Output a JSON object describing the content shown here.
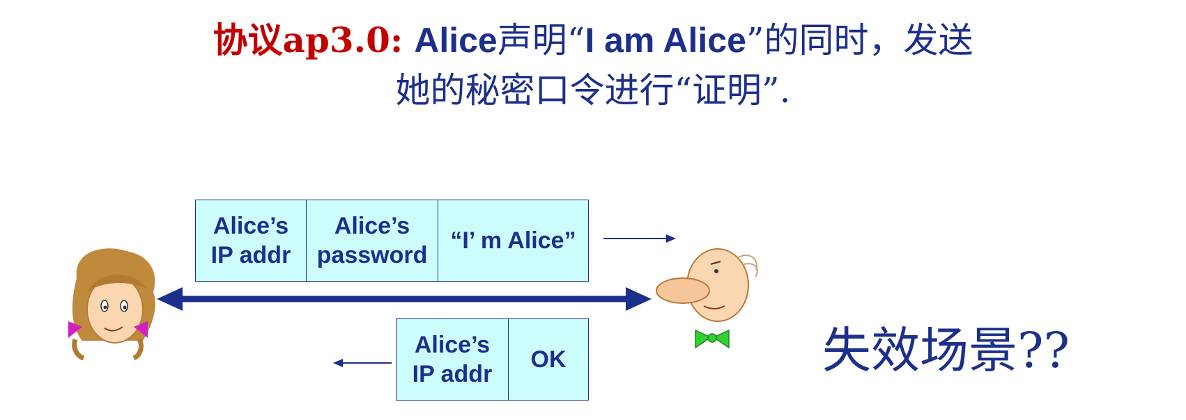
{
  "title": {
    "protocol_label": "协议ap3.0:",
    "alice_name": "Alice",
    "claim_text_1": "声明“",
    "claim_quote": "I am Alice",
    "claim_text_2": "”的同时，发送",
    "line2": "她的秘密口令进行“证明”."
  },
  "message_1": {
    "cells": [
      [
        "Alice’s",
        "IP addr"
      ],
      [
        "Alice’s",
        "password"
      ],
      [
        "“I’ m Alice”"
      ]
    ]
  },
  "message_2": {
    "cells": [
      [
        "Alice’s",
        "IP addr"
      ],
      [
        "OK"
      ]
    ]
  },
  "failure_label": "失效场景??",
  "colors": {
    "text_blue": "#1c2f8a",
    "title_red": "#c00000",
    "box_fill": "#ccfcfc"
  },
  "icons": [
    "alice-character-icon",
    "bob-character-icon"
  ]
}
